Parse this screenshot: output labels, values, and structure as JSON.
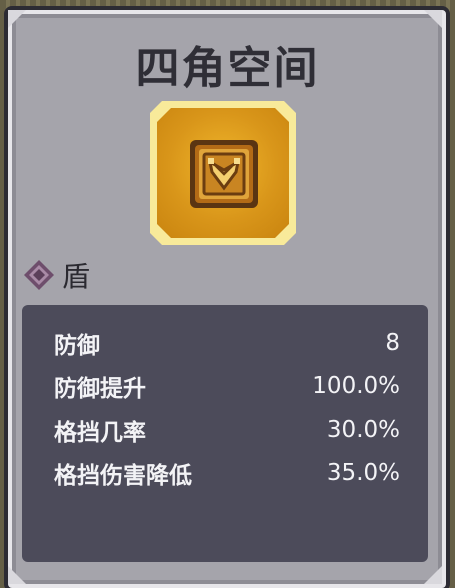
{
  "item": {
    "name": "四角空间",
    "type_label": "盾",
    "icon": "golden-square-shield-icon",
    "rarity_color": "#f0b62b"
  },
  "stats": [
    {
      "label": "防御",
      "value": "8"
    },
    {
      "label": "防御提升",
      "value": "100.0%"
    },
    {
      "label": "格挡几率",
      "value": "30.0%"
    },
    {
      "label": "格挡伤害降低",
      "value": "35.0%"
    }
  ],
  "colors": {
    "panel": "#a5a4ab",
    "stats_bg": "#4c4b5a",
    "title_text": "#2f2e36",
    "type_icon": "#7a5a78"
  }
}
